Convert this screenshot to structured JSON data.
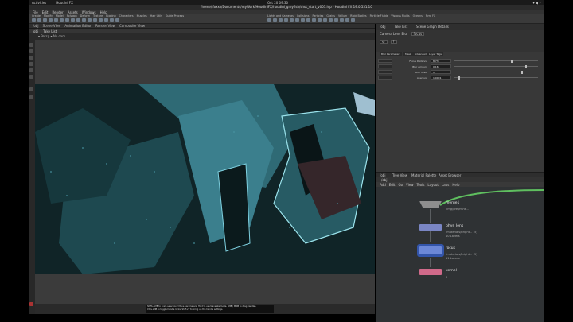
{
  "os": {
    "activities": "Activities",
    "app": "Houdini FX",
    "clock": "Oct 20 09:30",
    "tray": "▾ ◀ ⚡"
  },
  "window": {
    "title": "/home/jfoxxx/Documents/myWork/HoudiniFX/houdini_greyfish/shot_start_v001.hip - Houdini FX 19.0.531.10"
  },
  "menubar": [
    "File",
    "Edit",
    "Render",
    "Assets",
    "Windows",
    "Help"
  ],
  "shelf": {
    "tabs_left": [
      "Create",
      "Modify",
      "Model",
      "Polygon",
      "Deform",
      "Texture",
      "Rigging",
      "Characters",
      "Muscles",
      "Hair Utils",
      "Guide Process"
    ],
    "tabs_right": [
      "Lights and Cameras",
      "Collisions",
      "Particles",
      "Grains",
      "Vellum",
      "Rigid Bodies",
      "Particle Fluids",
      "Viscous Fluids",
      "Oceans",
      "Pyro FX"
    ]
  },
  "pathbar": [
    "/obj",
    "Scene View",
    "Animation Editor",
    "Render View",
    "Composite View"
  ],
  "tabs": [
    "obj",
    "Take List"
  ],
  "viewport": {
    "camera_label": "▾ Persp ▾  No cam",
    "hint_lines": [
      "Shift+LMB to scale selection / Move parameters. Hold to use translate mode. LMB / MMB to drag handles.",
      "Ctrl+LMB to toggle handle locks. Shift+V to bring up the handle settings."
    ]
  },
  "right_panel": {
    "top_tabs": [
      "/obj",
      "Take List",
      "Scene Graph Details"
    ],
    "node_type": "Camera Lens Blur",
    "node_name": "focus",
    "param_tabs": [
      "Blur Parameters",
      "Mask",
      "Advanced",
      "Layer Tags"
    ],
    "params": [
      {
        "name": "Focus Distance",
        "value": "8.73",
        "slider": 0.68
      },
      {
        "name": "Blur Amount",
        "value": "0.16",
        "slider": 0.85
      },
      {
        "name": "Blur Scale",
        "value": "1",
        "slider": 0.8
      },
      {
        "name": "Aperture",
        "value": "1.0001",
        "slider": 0.05
      }
    ]
  },
  "network": {
    "tabs": [
      "/obj",
      "Tree View",
      "Material Palette",
      "Asset Browser"
    ],
    "path": "/obj",
    "tools": [
      "Add",
      "Edit",
      "Go",
      "View",
      "Tools",
      "Layout",
      "Labs",
      "Help"
    ],
    "nodes": [
      {
        "name": "merge1",
        "info1": "/img/greyfishs...",
        "info2": "",
        "color": "#8e8e8e",
        "flag": "#6b8e23"
      },
      {
        "name": "phys_lens",
        "info1": "/materials/bright... (5)",
        "info2": "10 Layers",
        "color": "#7a86c4",
        "flag": "#5a5a5a"
      },
      {
        "name": "focus",
        "info1": "/materials/bright... (5)",
        "info2": "11 Layers",
        "color": "#6c88d8",
        "flag": "#5a5a5a"
      },
      {
        "name": "kernel",
        "info1": "/materials/focus",
        "info2": "11 Layers",
        "color": "#d06a8a",
        "flag": "#5a5a5a"
      }
    ],
    "extra": "0"
  }
}
